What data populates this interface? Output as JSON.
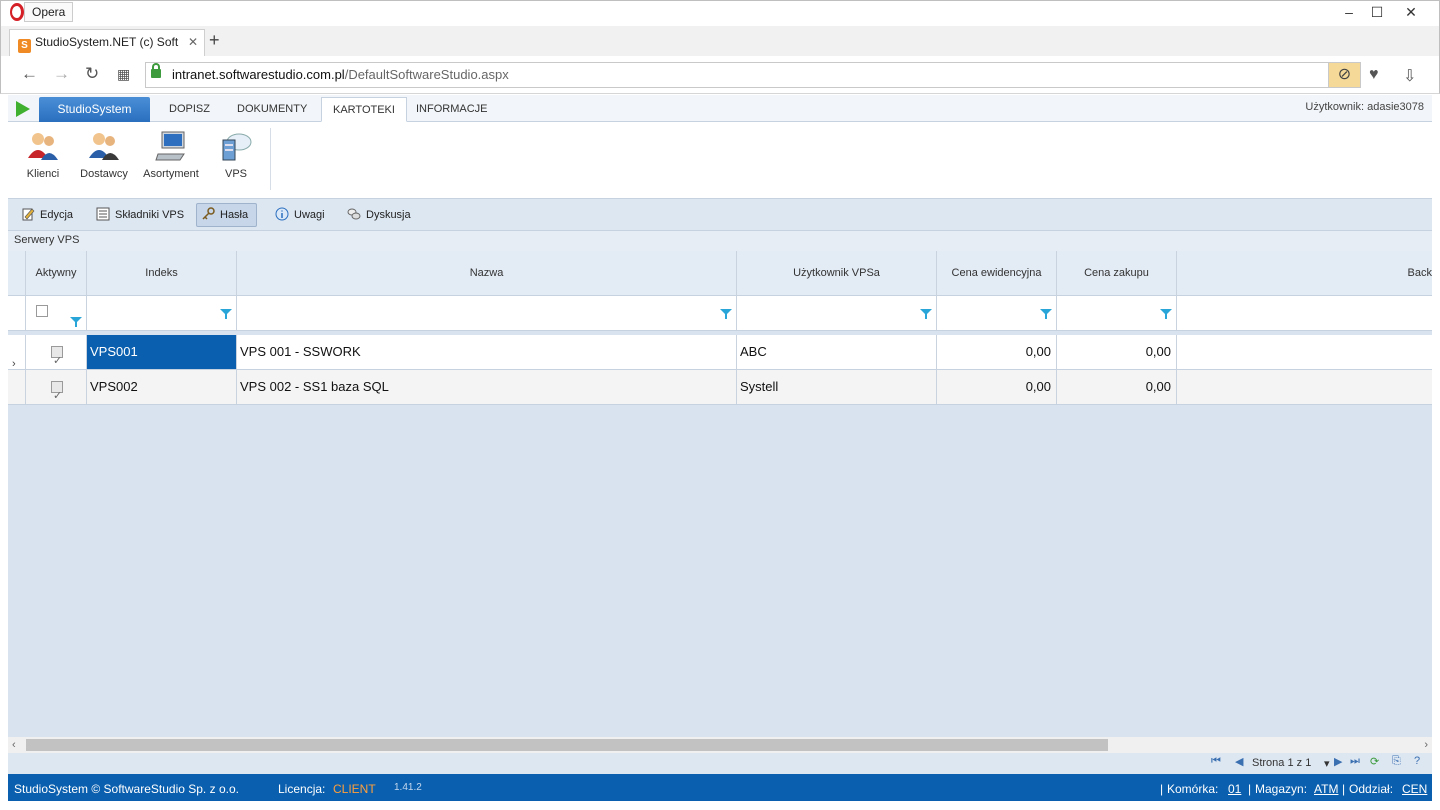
{
  "browser": {
    "app_name": "Opera",
    "tab_title": "StudioSystem.NET (c) Soft",
    "url_domain": "intranet.softwarestudio.com.pl",
    "url_path": "/DefaultSoftwareStudio.aspx"
  },
  "menu": {
    "main": "StudioSystem",
    "items": [
      "DOPISZ",
      "DOKUMENTY",
      "KARTOTEKI",
      "INFORMACJE"
    ],
    "active": "KARTOTEKI",
    "user_label": "Użytkownik: adasie3078"
  },
  "ribbon": {
    "buttons": [
      "Klienci",
      "Dostawcy",
      "Asortyment",
      "VPS"
    ]
  },
  "toolbar": {
    "buttons": [
      "Edycja",
      "Składniki VPS",
      "Hasła",
      "Uwagi",
      "Dyskusja"
    ],
    "active": "Hasła"
  },
  "grid": {
    "caption": "Serwery VPS",
    "columns": [
      "Aktywny",
      "Indeks",
      "Nazwa",
      "Użytkownik VPSa",
      "Cena ewidencyjna",
      "Cena zakupu",
      "Back"
    ],
    "rows": [
      {
        "active": true,
        "index": "VPS001",
        "name": "VPS 001 - SSWORK",
        "user": "ABC",
        "cena_ew": "0,00",
        "cena_zak": "0,00"
      },
      {
        "active": true,
        "index": "VPS002",
        "name": "VPS 002 - SS1 baza SQL",
        "user": "Systell",
        "cena_ew": "0,00",
        "cena_zak": "0,00"
      }
    ]
  },
  "pager": {
    "text": "Strona 1 z 1"
  },
  "status": {
    "copyright": "StudioSystem © SoftwareStudio Sp. z o.o.",
    "license_label": "Licencja:",
    "license_value": "CLIENT",
    "version": "1.41.2",
    "komorka_label": "Komórka:",
    "komorka_value": "01",
    "magazyn_label": "Magazyn:",
    "magazyn_value": "ATM",
    "oddzial_label": "Oddział:",
    "oddzial_value": "CEN"
  },
  "colors": {
    "accent": "#0a5fae",
    "selection": "#0a5fae",
    "license": "#ff9f3b"
  }
}
